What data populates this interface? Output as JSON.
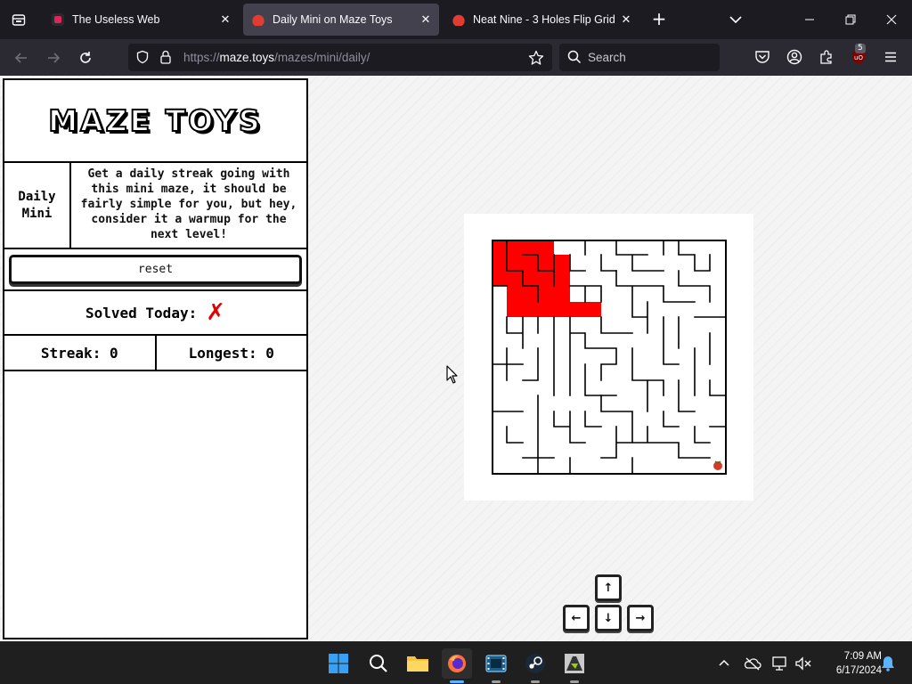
{
  "browser": {
    "tabs": [
      {
        "label": "The Useless Web",
        "favicon_color": "#e0245e",
        "active": false
      },
      {
        "label": "Daily Mini on Maze Toys",
        "favicon_color": "#e03c31",
        "active": true
      },
      {
        "label": "Neat Nine - 3 Holes Flip Grid",
        "favicon_color": "#e03c31",
        "active": false
      }
    ],
    "url": {
      "prefix": "https://",
      "host": "maze.toys",
      "path": "/mazes/mini/daily/"
    },
    "search_placeholder": "Search",
    "extension_badge": "5"
  },
  "page": {
    "logo": "MAZE TOYS",
    "daily_label_line1": "Daily",
    "daily_label_line2": "Mini",
    "description": "Get a daily streak going with this mini maze, it should be fairly simple for you, but hey, consider it a warmup for the next level!",
    "reset_label": "reset",
    "solved_label": "Solved Today:",
    "solved_mark": "✗",
    "streak_label": "Streak:",
    "streak_value": "0",
    "longest_label": "Longest:",
    "longest_value": "0",
    "path_color": "#ff0000",
    "arrow_keys": {
      "up": "↑",
      "left": "←",
      "down": "↓",
      "right": "→"
    }
  },
  "taskbar": {
    "time": "7:09 AM",
    "date": "6/17/2024"
  }
}
